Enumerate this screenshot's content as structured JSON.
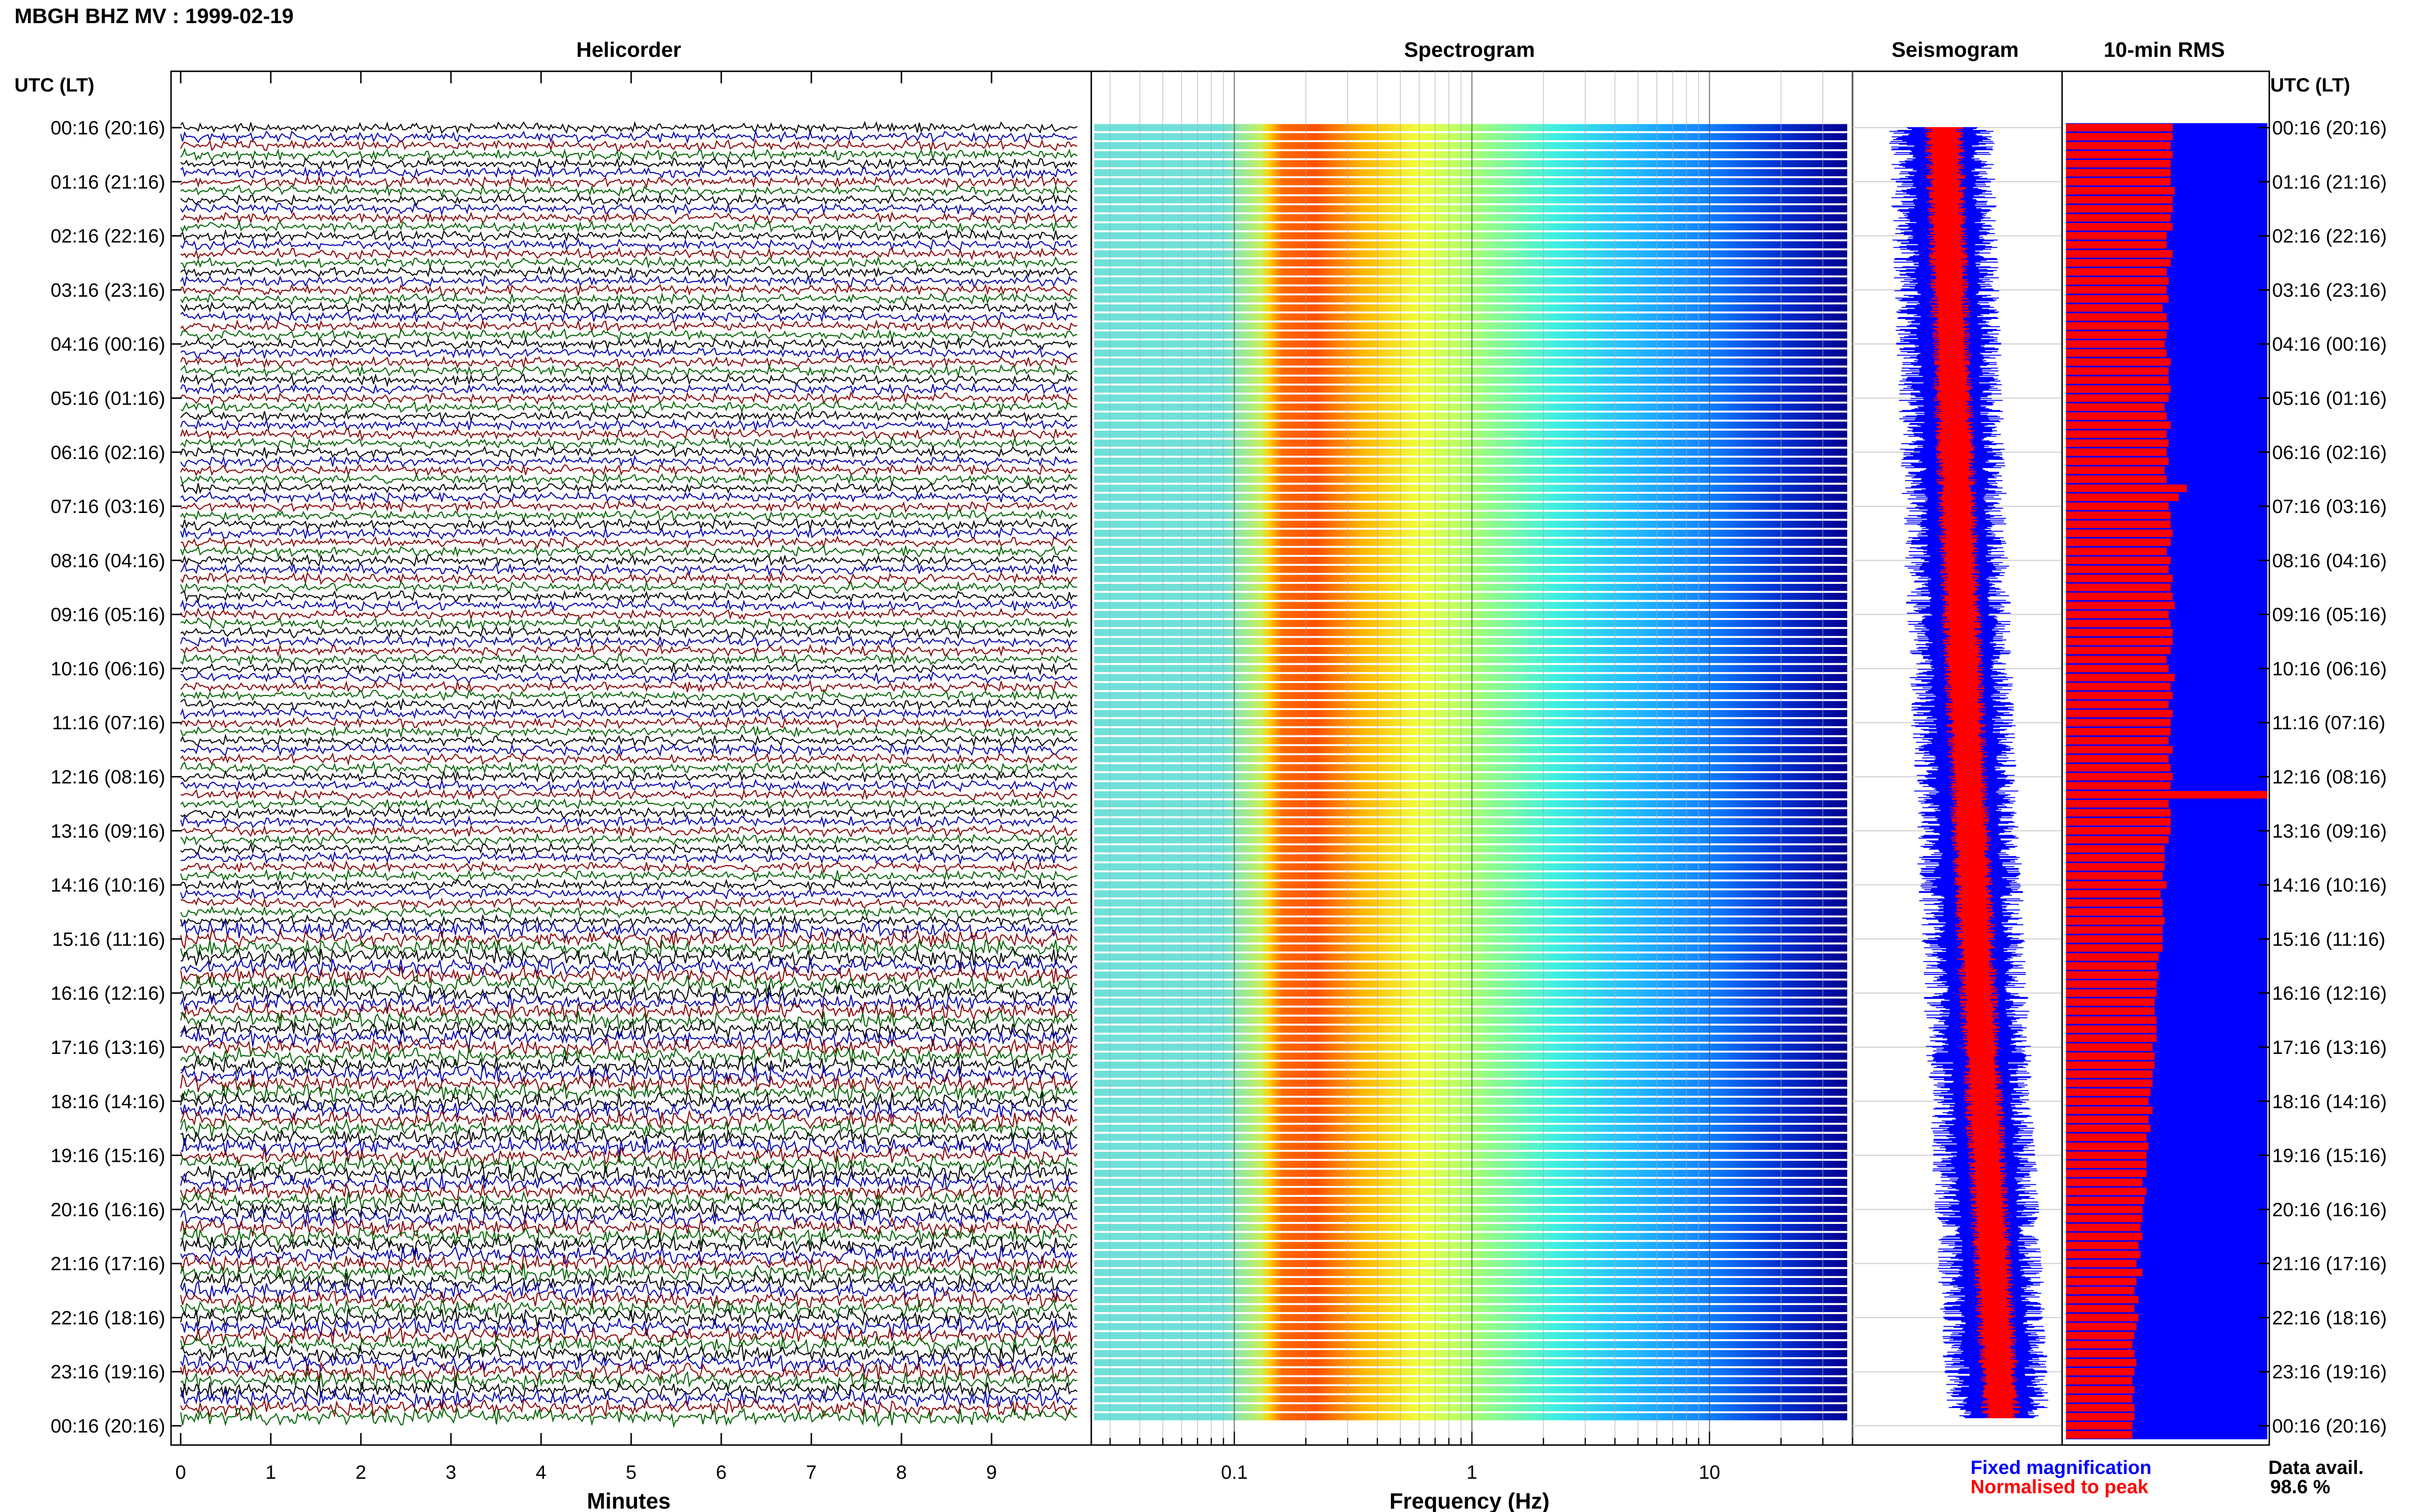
{
  "title": "MBGH BHZ MV : 1999-02-19",
  "row_axis_label_left": "UTC (LT)",
  "row_axis_label_right": "UTC (LT)",
  "time_labels": [
    "00:16 (20:16)",
    "01:16 (21:16)",
    "02:16 (22:16)",
    "03:16 (23:16)",
    "04:16 (00:16)",
    "05:16 (01:16)",
    "06:16 (02:16)",
    "07:16 (03:16)",
    "08:16 (04:16)",
    "09:16 (05:16)",
    "10:16 (06:16)",
    "11:16 (07:16)",
    "12:16 (08:16)",
    "13:16 (09:16)",
    "14:16 (10:16)",
    "15:16 (11:16)",
    "16:16 (12:16)",
    "17:16 (13:16)",
    "18:16 (14:16)",
    "19:16 (15:16)",
    "20:16 (16:16)",
    "21:16 (17:16)",
    "22:16 (18:16)",
    "23:16 (19:16)",
    "00:16 (20:16)"
  ],
  "panels": {
    "helicorder": {
      "title": "Helicorder",
      "xlabel": "Minutes",
      "ticks": [
        "0",
        "1",
        "2",
        "3",
        "4",
        "5",
        "6",
        "7",
        "8",
        "9"
      ],
      "xlim": [
        0,
        10
      ],
      "trace_colors": [
        "#000000",
        "#0000b4",
        "#8b0000",
        "#006400"
      ]
    },
    "spectrogram": {
      "title": "Spectrogram",
      "xlabel": "Frequency (Hz)",
      "ticks": [
        "0.1",
        "1",
        "10"
      ],
      "xscale": "log",
      "xlim": [
        0.025,
        40
      ]
    },
    "seismogram": {
      "title": "Seismogram"
    },
    "rms": {
      "title": "10-min RMS"
    }
  },
  "legend": {
    "fixed": "Fixed magnification",
    "normalised": "Normalised to peak",
    "fixed_color": "#0000ff",
    "normalised_color": "#ff0000"
  },
  "data_avail": {
    "label": "Data avail.",
    "value": "98.6 %"
  },
  "chart_data": [
    {
      "type": "line",
      "title": "Helicorder",
      "xlabel": "Minutes",
      "ylabel": "UTC (LT)",
      "xlim": [
        0,
        10
      ],
      "rows_per_hour": 6,
      "hours": 24,
      "grid": true
    },
    {
      "type": "heatmap",
      "title": "Spectrogram",
      "xlabel": "Frequency (Hz)",
      "xscale": "log",
      "xlim": [
        0.025,
        40
      ],
      "peak_band_hz": [
        0.14,
        0.4
      ],
      "grid": true
    },
    {
      "type": "line",
      "title": "Seismogram",
      "series": [
        {
          "name": "Fixed magnification",
          "color": "#0000ff"
        },
        {
          "name": "Normalised to peak",
          "color": "#ff0000"
        }
      ]
    },
    {
      "type": "bar",
      "title": "10-min RMS",
      "series": [
        {
          "name": "Fixed magnification",
          "color": "#0000ff"
        },
        {
          "name": "Normalised to peak",
          "color": "#ff0000"
        }
      ],
      "values_normalised": [
        0.53,
        0.53,
        0.52,
        0.53,
        0.52,
        0.52,
        0.52,
        0.54,
        0.53,
        0.53,
        0.52,
        0.53,
        0.5,
        0.5,
        0.53,
        0.52,
        0.5,
        0.51,
        0.5,
        0.51,
        0.48,
        0.5,
        0.51,
        0.5,
        0.49,
        0.5,
        0.52,
        0.51,
        0.51,
        0.52,
        0.51,
        0.49,
        0.5,
        0.52,
        0.5,
        0.51,
        0.5,
        0.51,
        0.49,
        0.5,
        0.6,
        0.56,
        0.51,
        0.52,
        0.52,
        0.53,
        0.52,
        0.5,
        0.52,
        0.51,
        0.53,
        0.52,
        0.53,
        0.54,
        0.51,
        0.52,
        0.53,
        0.53,
        0.52,
        0.5,
        0.51,
        0.54,
        0.52,
        0.53,
        0.51,
        0.53,
        0.52,
        0.52,
        0.51,
        0.53,
        0.51,
        0.52,
        0.53,
        0.52,
        1.0,
        0.51,
        0.52,
        0.52,
        0.52,
        0.51,
        0.49,
        0.49,
        0.49,
        0.48,
        0.5,
        0.47,
        0.48,
        0.48,
        0.49,
        0.48,
        0.48,
        0.48,
        0.46,
        0.45,
        0.46,
        0.45,
        0.45,
        0.44,
        0.44,
        0.45,
        0.45,
        0.45,
        0.43,
        0.44,
        0.44,
        0.43,
        0.43,
        0.42,
        0.41,
        0.43,
        0.41,
        0.42,
        0.4,
        0.41,
        0.4,
        0.4,
        0.4,
        0.38,
        0.4,
        0.39,
        0.38,
        0.38,
        0.37,
        0.38,
        0.36,
        0.37,
        0.35,
        0.38,
        0.35,
        0.34,
        0.36,
        0.34,
        0.36,
        0.35,
        0.34,
        0.33,
        0.34,
        0.35,
        0.34,
        0.33,
        0.34,
        0.33,
        0.34,
        0.34,
        0.33,
        0.33
      ]
    }
  ]
}
